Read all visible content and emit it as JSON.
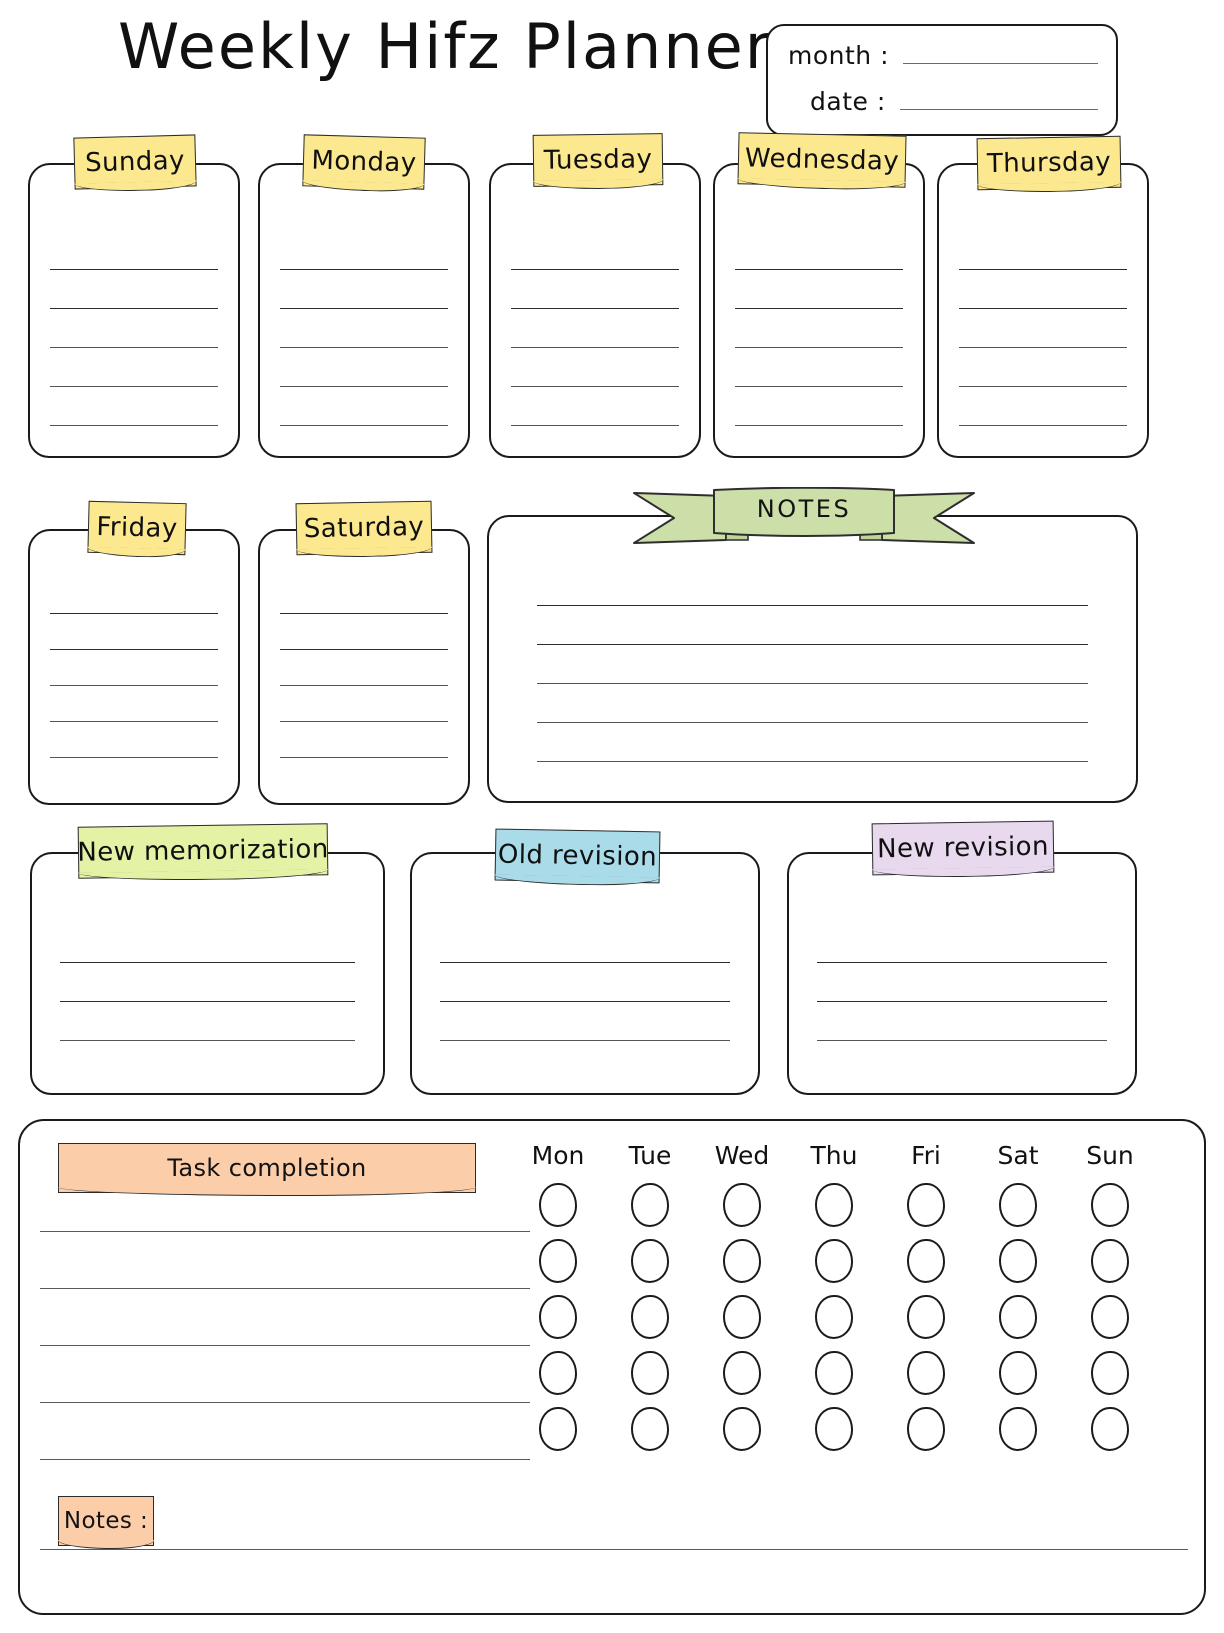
{
  "header": {
    "title": "Weekly Hifz Planner",
    "month_label": "month :",
    "date_label": "date :",
    "month_value": "",
    "date_value": ""
  },
  "day_cards": [
    {
      "label": "Sunday",
      "lines": 5,
      "color": "#fbe88f"
    },
    {
      "label": "Monday",
      "lines": 5,
      "color": "#fbe88f"
    },
    {
      "label": "Tuesday",
      "lines": 5,
      "color": "#fbe88f"
    },
    {
      "label": "Wednesday",
      "lines": 5,
      "color": "#fbe88f"
    },
    {
      "label": "Thursday",
      "lines": 5,
      "color": "#fbe88f"
    },
    {
      "label": "Friday",
      "lines": 5,
      "color": "#fbe88f"
    },
    {
      "label": "Saturday",
      "lines": 5,
      "color": "#fbe88f"
    }
  ],
  "notes_panel": {
    "label": "NOTES",
    "lines": 5,
    "ribbon_color": "#ccdfa9"
  },
  "category_cards": [
    {
      "label": "New memorization",
      "lines": 3,
      "color": "#e3f2a4"
    },
    {
      "label": "Old revision",
      "lines": 3,
      "color": "#a9dbe9"
    },
    {
      "label": "New revision",
      "lines": 3,
      "color": "#e8d9ef"
    }
  ],
  "task_panel": {
    "title": "Task completion",
    "title_color": "#fbcda9",
    "notes_label": "Notes :",
    "notes_color": "#fbcda9",
    "task_lines": 5,
    "day_headers": [
      "Mon",
      "Tue",
      "Wed",
      "Thu",
      "Fri",
      "Sat",
      "Sun"
    ],
    "circle_rows": 5,
    "circle_cols": 7
  },
  "colors": {
    "ink": "#1a1a1a",
    "rule": "#555555",
    "paper": "#ffffff",
    "sticky_yellow": "#fbe88f",
    "sticky_lime": "#e3f2a4",
    "sticky_blue": "#a9dbe9",
    "sticky_purple": "#e8d9ef",
    "sticky_peach": "#fbcda9",
    "ribbon_green": "#ccdfa9"
  }
}
